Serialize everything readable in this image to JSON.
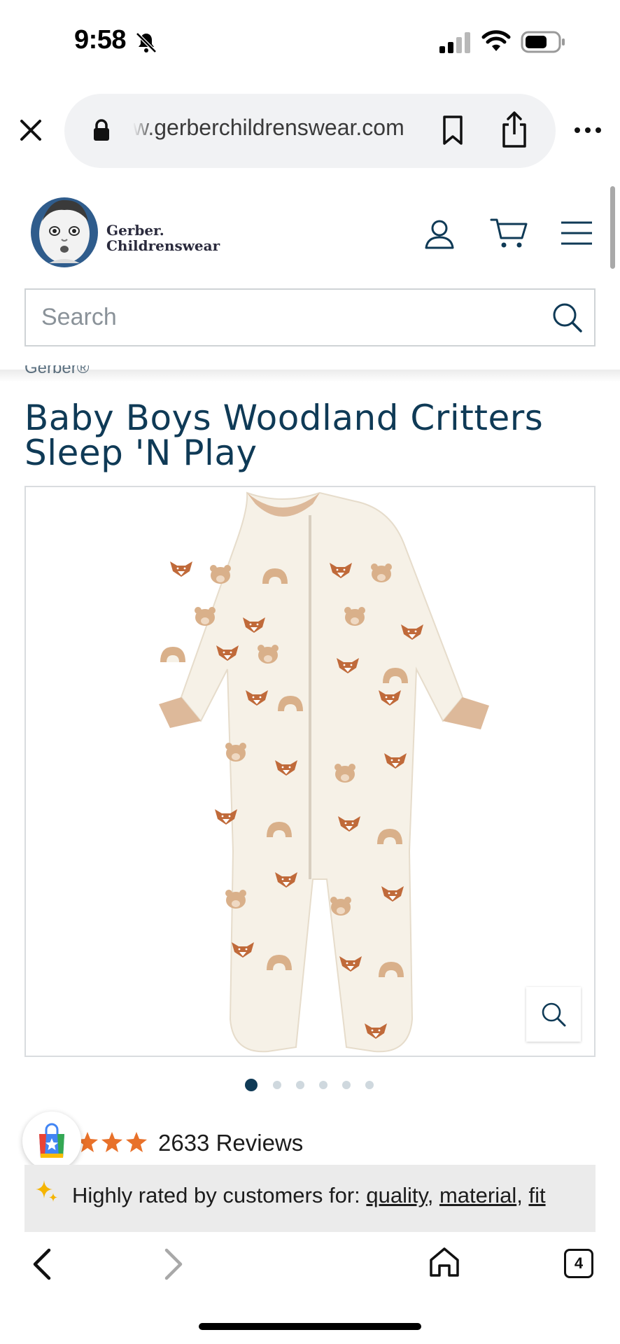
{
  "status_bar": {
    "time": "9:58",
    "icons": [
      "bell-slash-icon",
      "signal-icon",
      "wifi-icon",
      "battery-icon"
    ]
  },
  "browser": {
    "url": "w.gerberchildrenswear.com",
    "icons": [
      "close-icon",
      "lock-icon",
      "bookmark-icon",
      "share-icon",
      "more-icon"
    ]
  },
  "header": {
    "logo_line1": "Gerber.",
    "logo_line2": "Childrenswear",
    "search_placeholder": "Search",
    "icons": [
      "account-icon",
      "cart-icon",
      "menu-icon",
      "search-icon"
    ]
  },
  "product": {
    "brand": "Gerber®",
    "title": "Baby Boys Woodland Critters Sleep 'N Play",
    "image_count": 6,
    "active_image": 1,
    "rating_stars_visible": 3,
    "reviews_label": "2633 Reviews",
    "highlight_prefix": "Highly rated by customers for: ",
    "highlight_keyword_1": "quality",
    "highlight_sep_1": ",",
    "highlight_keyword_2": "material",
    "highlight_sep_2": ", ",
    "highlight_keyword_3": "fit",
    "colors": {
      "title": "#0f3a56",
      "star": "#e8712a",
      "garment": "#f6f1e7",
      "trim": "#ddb99a",
      "fox": "#c06a3a",
      "bear": "#d9b08a"
    }
  },
  "toolbar": {
    "tab_count": "4",
    "icons": [
      "back-icon",
      "forward-icon",
      "home-icon",
      "tabs-icon"
    ]
  }
}
